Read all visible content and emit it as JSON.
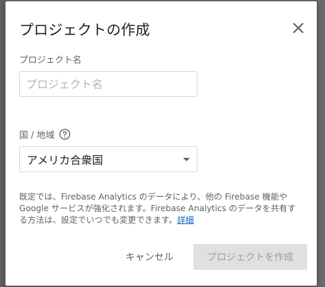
{
  "dialog": {
    "title": "プロジェクトの作成",
    "close_icon": "close-icon"
  },
  "project_name": {
    "label": "プロジェクト名",
    "value": "",
    "placeholder": "プロジェクト名"
  },
  "country": {
    "label": "国 / 地域",
    "help_icon": "help-circle-icon",
    "selected": "アメリカ合衆国"
  },
  "notice": {
    "text": "既定では、Firebase Analytics のデータにより、他の Firebase 機能や Google サービスが強化されます。Firebase Analytics のデータを共有する方法は、設定でいつでも変更できます。",
    "link_label": "詳細"
  },
  "actions": {
    "cancel_label": "キャンセル",
    "create_label": "プロジェクトを作成",
    "create_disabled": true
  },
  "colors": {
    "link": "#1565c0",
    "disabled_button_bg": "#e0e0e0"
  }
}
